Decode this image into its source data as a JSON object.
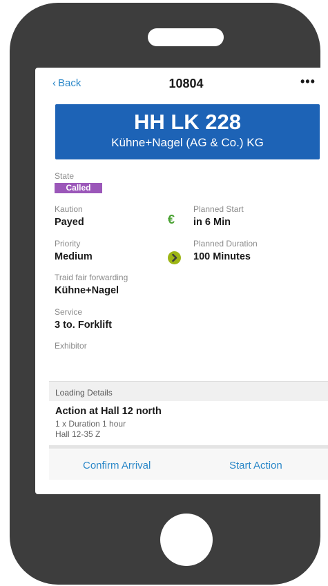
{
  "navbar": {
    "back_label": "Back",
    "title": "10804",
    "more_label": "•••"
  },
  "plate": {
    "number": "HH LK 228",
    "company": "Kühne+Nagel (AG & Co.) KG"
  },
  "state": {
    "label": "State",
    "value": "Called",
    "color": "#9b57b9"
  },
  "kaution": {
    "label": "Kaution",
    "value": "Payed"
  },
  "planned_start": {
    "label": "Planned Start",
    "value": "in 6 Min",
    "icon": "€"
  },
  "priority": {
    "label": "Priority",
    "value": "Medium"
  },
  "planned_duration": {
    "label": "Planned Duration",
    "value": "100 Minutes"
  },
  "forwarding": {
    "label": "Traid fair forwarding",
    "value": "Kühne+Nagel"
  },
  "service": {
    "label": "Service",
    "value": "3 to. Forklift"
  },
  "exhibitor": {
    "label": "Exhibitor"
  },
  "loading": {
    "header": "Loading Details",
    "title": "Action at Hall 12 north",
    "line1": "1 x Duration 1 hour",
    "line2": "Hall 12-35 Z"
  },
  "actions": {
    "confirm_label": "Confirm Arrival",
    "start_label": "Start Action"
  },
  "colors": {
    "accent": "#2a87c8",
    "plate": "#1d63b6",
    "euro": "#4aa233",
    "arrow": "#9db515"
  }
}
